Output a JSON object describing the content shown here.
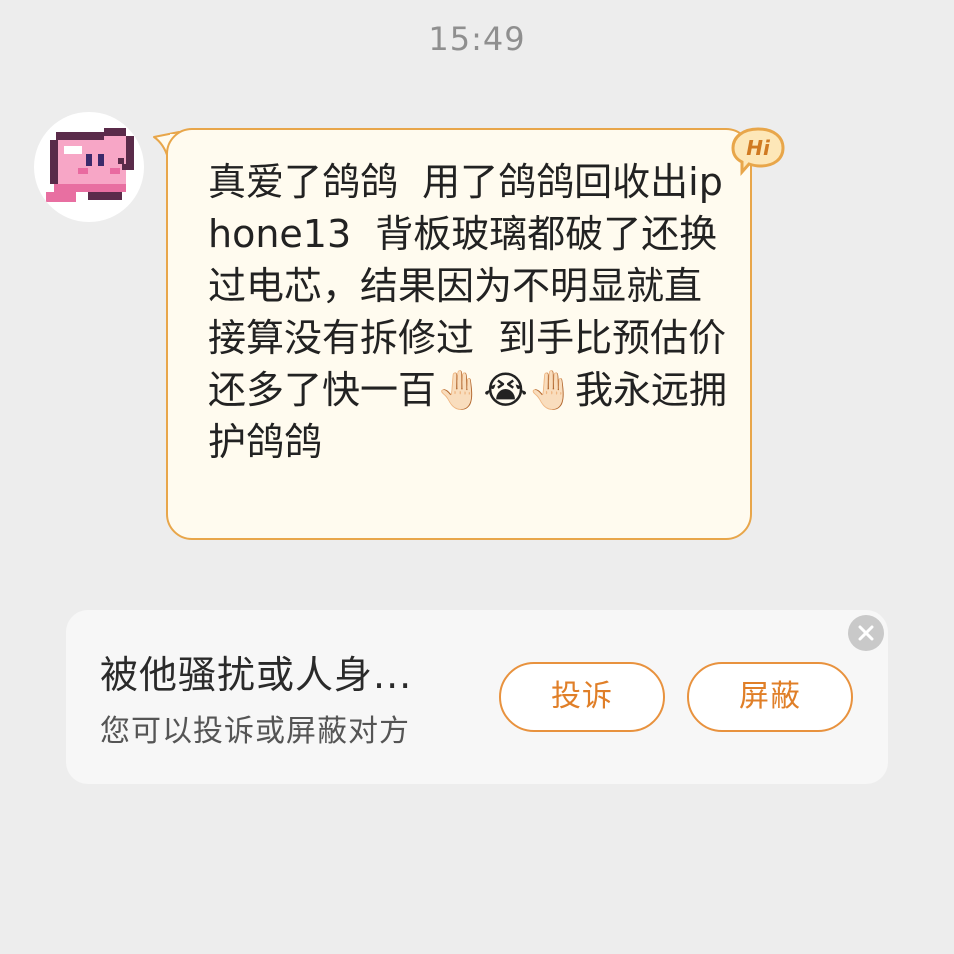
{
  "chat": {
    "timestamp": "15:49",
    "message": {
      "text": "真爱了鸽鸽  用了鸽鸽回收出iphone13  背板玻璃都破了还换过电芯，结果因为不明显就直接算没有拆修过  到手比预估价还多了快一百🤚🏻😭🤚🏻我永远拥护鸽鸽",
      "badge": "Hi"
    },
    "sender_avatar_icon": "pink-kirby-pixel-avatar"
  },
  "report_card": {
    "title": "被他骚扰或人身...",
    "subtitle": "您可以投诉或屏蔽对方",
    "report_label": "投诉",
    "block_label": "屏蔽"
  },
  "colors": {
    "accent": "#e8923e",
    "bubble_bg": "#fffbef",
    "page_bg": "#ededed"
  }
}
